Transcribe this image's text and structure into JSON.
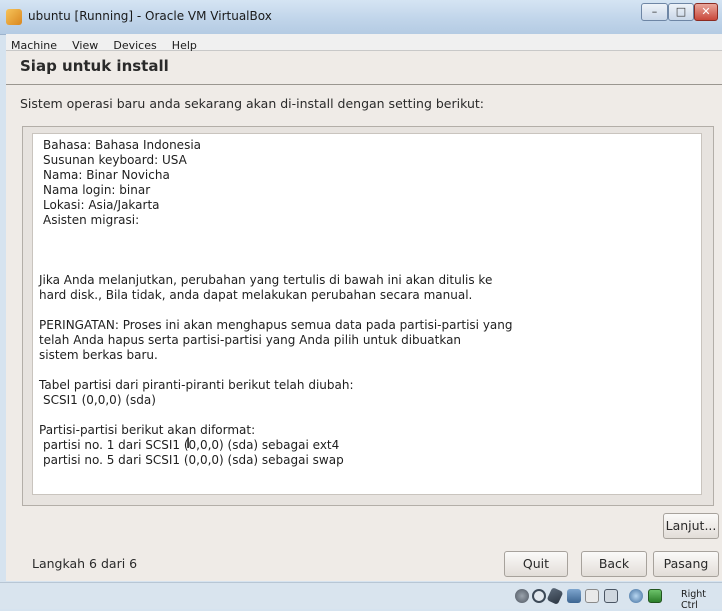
{
  "window": {
    "title": "ubuntu [Running] - Oracle VM VirtualBox"
  },
  "menu": [
    "Machine",
    "View",
    "Devices",
    "Help"
  ],
  "installer": {
    "title": "Siap untuk install",
    "subtitle": "Sistem operasi baru anda sekarang akan di-install dengan setting berikut:",
    "summary": [
      "Bahasa: Bahasa Indonesia",
      "Susunan keyboard: USA",
      "Nama: Binar Novicha",
      "Nama login: binar",
      "Lokasi: Asia/Jakarta",
      "Asisten migrasi:"
    ],
    "notice": [
      "Jika Anda melanjutkan, perubahan yang tertulis di bawah ini akan ditulis ke",
      "hard disk., Bila tidak, anda dapat melakukan perubahan secara manual."
    ],
    "warning": [
      "PERINGATAN: Proses ini akan menghapus semua data pada partisi-partisi yang",
      "telah Anda hapus serta partisi-partisi yang Anda pilih untuk dibuatkan",
      "sistem berkas baru."
    ],
    "partition_table_heading": "Tabel partisi dari piranti-piranti berikut telah diubah:",
    "partition_table_items": [
      "SCSI1 (0,0,0) (sda)"
    ],
    "format_heading": "Partisi-partisi berikut akan diformat:",
    "format_items": [
      "partisi no. 1 dari SCSI1 (0,0,0) (sda) sebagai ext4",
      "partisi no. 5 dari SCSI1 (0,0,0) (sda) sebagai swap"
    ],
    "buttons": {
      "advanced": "Lanjut...",
      "quit": "Quit",
      "back": "Back",
      "install": "Pasang"
    },
    "step": "Langkah 6 dari 6"
  },
  "statusbar": {
    "host_key": "Right Ctrl"
  },
  "icons": [
    "app-icon",
    "minimize-icon",
    "maximize-icon",
    "close-icon",
    "hdd-icon",
    "cd-icon",
    "usb-icon",
    "network-icon",
    "shared-folder-icon",
    "display-icon",
    "mouse-integration-icon",
    "host-key-icon"
  ]
}
